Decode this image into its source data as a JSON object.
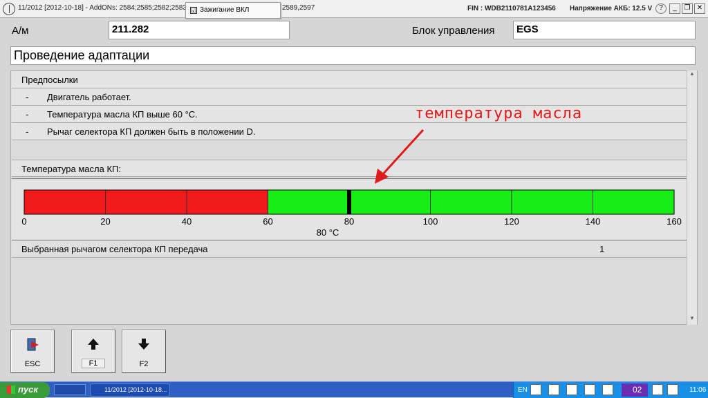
{
  "window": {
    "title": "11/2012 [2012-10-18] - AddONs: 2584;2585;2582;2583;2",
    "title_tail": "2589,2597",
    "popup_check": "☑",
    "popup_label": "Зажигание ВКЛ",
    "fin": "FIN : WDB2110781A123456",
    "battery": "Напряжение АКБ: 12.5 V",
    "btn_help": "?",
    "btn_min": "_",
    "btn_restore": "❐",
    "btn_close": "✕"
  },
  "header": {
    "am_label": "А/м",
    "am_value": "211.282",
    "block_label": "Блок управления",
    "block_value": "EGS",
    "page_title": "Проведение адаптации"
  },
  "preconditions": {
    "heading": "Предпосылки",
    "items": [
      {
        "dash": "-",
        "text": "Двигатель работает."
      },
      {
        "dash": "-",
        "text": "Температура масла КП выше 60 °C."
      },
      {
        "dash": "-",
        "text": "Рычаг селектора КП должен быть в положении D."
      }
    ]
  },
  "oil_temp": {
    "label": "Температура масла КП:",
    "value_text": "80 °C",
    "value": 80,
    "min": 0,
    "max": 160,
    "threshold": 60,
    "ticks": [
      "0",
      "20",
      "40",
      "60",
      "80",
      "100",
      "120",
      "140",
      "160"
    ],
    "colors": {
      "low": "#f21a1a",
      "ok": "#16ee16",
      "marker": "#000000"
    }
  },
  "gear": {
    "label": "Выбранная рычагом селектора КП передача",
    "value": "1"
  },
  "annotation": {
    "text": "температура масла",
    "color": "#e01a1a"
  },
  "buttons": [
    {
      "label": "ESC",
      "icon": "exit-door-icon"
    },
    {
      "label": "F1",
      "icon": "arrow-up-icon"
    },
    {
      "label": "F2",
      "icon": "arrow-down-icon"
    }
  ],
  "taskbar": {
    "start": "пуск",
    "app": "11/2012 [2012-10-18...",
    "lang": "EN",
    "badge": "02",
    "clock": "11:06"
  }
}
